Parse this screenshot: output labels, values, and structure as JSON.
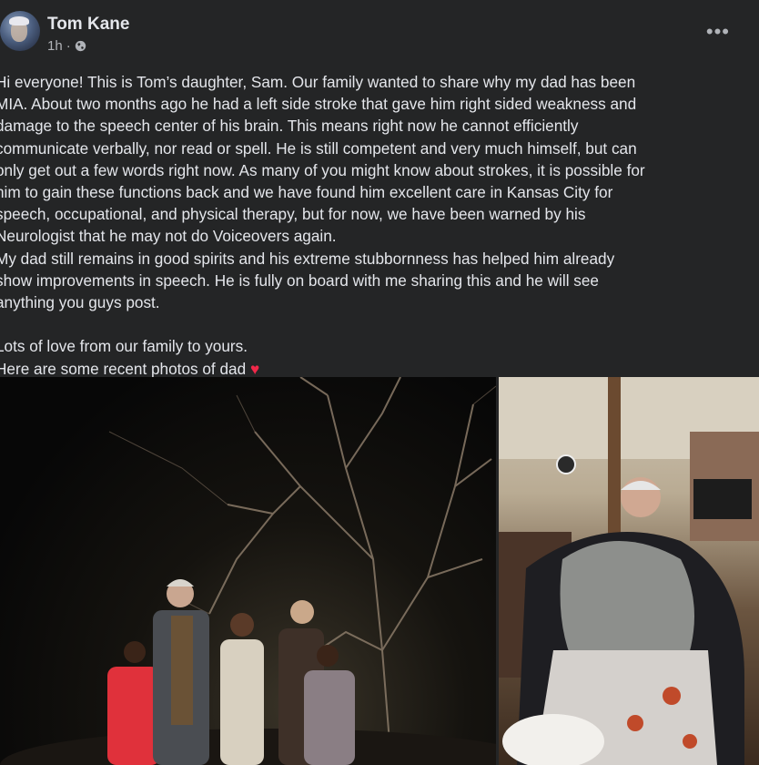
{
  "post": {
    "author": "Tom Kane",
    "timestamp": "1h",
    "privacy_icon": "globe-icon",
    "more_icon": "more-options-icon",
    "more_glyph": "•••",
    "text": "Hi everyone! This is Tom’s daughter, Sam. Our family wanted to share why my dad has been\nMIA. About two months ago he had a left side stroke that gave him right sided weakness and\ndamage to the speech center of his brain. This means right now he cannot efficiently\ncommunicate verbally, nor read or spell. He is still competent and very much himself, but can\nonly get out a few words right now. As many of you might know about strokes, it is possible for\nhim to gain these functions back and we have found him excellent care in Kansas City for\nspeech, occupational, and physical therapy, but for now, we have been warned by his\nNeurologist that he may not do Voiceovers again.\nMy dad still remains in good spirits and his extreme stubbornness has helped him already\nshow improvements in speech. He is fully on board with me sharing this and he will see\nanything you guys post.\n\nLots of love from our family to yours.\nHere are some recent photos of dad ",
    "heart_emoji": "♥"
  },
  "colors": {
    "background": "#242526",
    "text": "#e4e6eb",
    "secondary_text": "#b0b3b8",
    "heart": "#f02849"
  }
}
